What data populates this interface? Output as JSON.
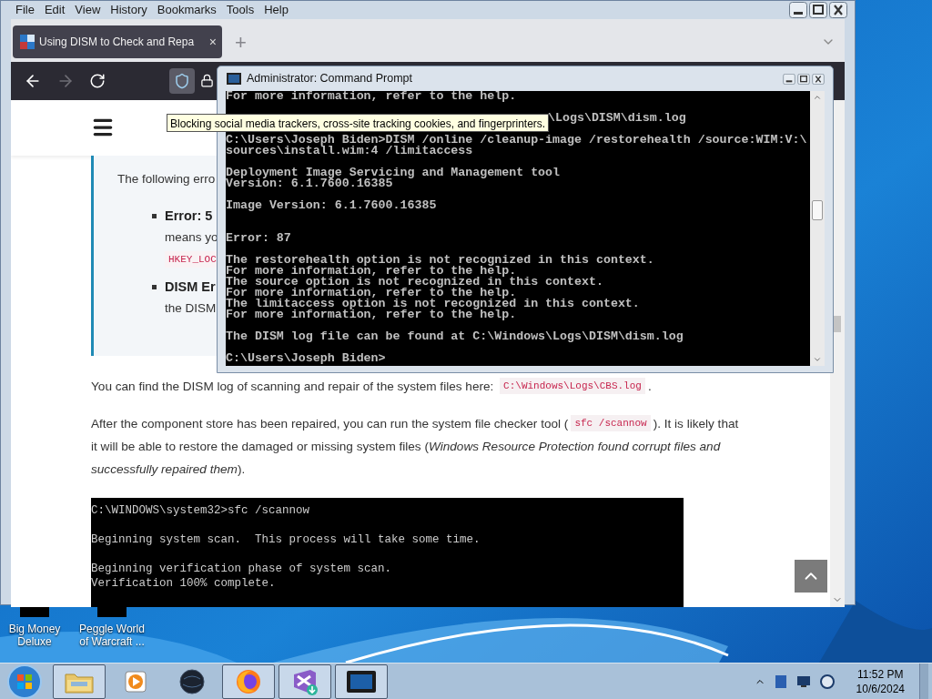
{
  "browser": {
    "menu": [
      "File",
      "Edit",
      "View",
      "History",
      "Bookmarks",
      "Tools",
      "Help"
    ],
    "tab": {
      "title": "Using DISM to Check and Repa",
      "close": "×",
      "selected": true
    },
    "new_tab": "+",
    "nav": {
      "forward_disabled": true,
      "shield_highlighted": true
    },
    "tooltip": "Blocking social media trackers, cross-site tracking cookies, and fingerprinters.",
    "page": {
      "callout": {
        "intro": "The following erro",
        "items": [
          {
            "title": "Error: 5",
            "lines": [
              {
                "kind": "text",
                "text": "means yo"
              },
              {
                "kind": "code",
                "text": "HKEY_LOC"
              }
            ]
          },
          {
            "title": "DISM Er",
            "lines": [
              {
                "kind": "text",
                "text": "the DISM"
              }
            ]
          }
        ]
      },
      "paragraphs": [
        [
          [
            {
              "kind": "text",
              "text": "You can find the DISM log of scanning and repair of the system files here: "
            },
            {
              "kind": "code",
              "text": "C:\\Windows\\Logs\\CBS.log"
            },
            {
              "kind": "text",
              "text": "."
            }
          ]
        ],
        [
          [
            {
              "kind": "text",
              "text": "After the component store has been repaired, you can run the system file checker tool ("
            },
            {
              "kind": "code",
              "text": "sfc /scannow"
            },
            {
              "kind": "text",
              "text": "). It is likely that"
            }
          ],
          [
            {
              "kind": "text",
              "text": "it will be able to restore the damaged or missing system files (*Windows Resource Protection found corrupt files and*"
            }
          ],
          [
            {
              "kind": "text",
              "text": "*successfully repaired them*)."
            }
          ]
        ]
      ],
      "code_block": [
        [
          "C:\\WINDOWS\\system32>sfc /scannow"
        ],
        [
          "Beginning system scan.  This process will take some time."
        ],
        [
          "Beginning verification phase of system scan.",
          "Verification 100% complete."
        ]
      ]
    }
  },
  "console": {
    "title": "Administrator: Command Prompt",
    "blocks": [
      {
        "kind": "normal",
        "lines": [
          "For more information, refer to the help."
        ]
      },
      {
        "kind": "covered",
        "lines": [
          "\\Logs\\DISM\\dism.log"
        ]
      },
      {
        "kind": "normal",
        "lines": [
          "C:\\Users\\Joseph Biden>DISM /online /cleanup-image /restorehealth /source:WIM:V:\\",
          "sources\\install.wim:4 /limitaccess"
        ]
      },
      {
        "kind": "normal",
        "lines": [
          "Deployment Image Servicing and Management tool",
          "Version: 6.1.7600.16385"
        ]
      },
      {
        "kind": "normal",
        "lines": [
          "Image Version: 6.1.7600.16385"
        ]
      },
      {
        "kind": "spaced",
        "lines": [
          "Error: 87"
        ]
      },
      {
        "kind": "normal",
        "lines": [
          "The restorehealth option is not recognized in this context.",
          "For more information, refer to the help.",
          "The source option is not recognized in this context.",
          "For more information, refer to the help.",
          "The limitaccess option is not recognized in this context.",
          "For more information, refer to the help."
        ]
      },
      {
        "kind": "normal",
        "lines": [
          "The DISM log file can be found at C:\\Windows\\Logs\\DISM\\dism.log"
        ]
      },
      {
        "kind": "normal",
        "lines": [
          "C:\\Users\\Joseph Biden>"
        ]
      }
    ]
  },
  "desktop": {
    "icons": [
      {
        "label": "Big Money Deluxe"
      },
      {
        "label": "Peggle World of Warcraft ..."
      }
    ]
  },
  "taskbar": {
    "buttons": [
      {
        "kind": "folder",
        "running": true
      },
      {
        "kind": "media",
        "running": false
      },
      {
        "kind": "globe",
        "running": false
      },
      {
        "kind": "firefox",
        "running": true
      },
      {
        "kind": "studio",
        "running": true
      },
      {
        "kind": "console",
        "running": true
      }
    ],
    "clock": {
      "time": "11:52 PM",
      "date": "10/6/2024"
    }
  }
}
